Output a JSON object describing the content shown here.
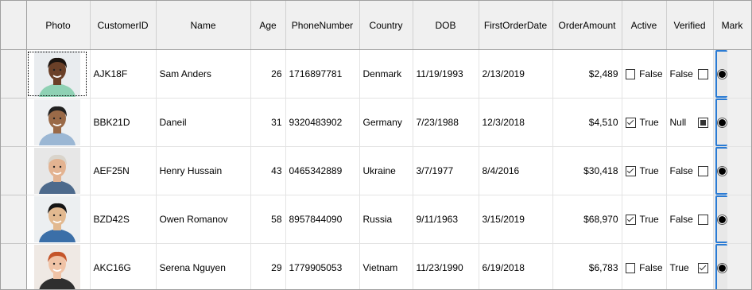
{
  "columns": {
    "photo": "Photo",
    "customer_id": "CustomerID",
    "name": "Name",
    "age": "Age",
    "phone": "PhoneNumber",
    "country": "Country",
    "dob": "DOB",
    "first_order": "FirstOrderDate",
    "order_amount": "OrderAmount",
    "active": "Active",
    "verified": "Verified",
    "mark": "Mark"
  },
  "colors": {
    "selection_blue": "#2a7bd4",
    "header_bg": "#f0f0f0"
  },
  "rows": [
    {
      "customer_id": "AJK18F",
      "name": "Sam Anders",
      "age": "26",
      "phone": "1716897781",
      "country": "Denmark",
      "dob": "11/19/1993",
      "first_order": "2/13/2019",
      "order_amount": "$2,489",
      "active": "False",
      "active_checked": false,
      "verified": "False",
      "verified_state": "unchecked",
      "avatar": {
        "skin": "#6b4028",
        "hair": "#1b1410",
        "shirt": "#8fd1b4",
        "bg": "#e9ecef"
      }
    },
    {
      "customer_id": "BBK21D",
      "name": "Daneil",
      "age": "31",
      "phone": "9320483902",
      "country": "Germany",
      "dob": "7/23/1988",
      "first_order": "12/3/2018",
      "order_amount": "$4,510",
      "active": "True",
      "active_checked": true,
      "verified": "Null",
      "verified_state": "indeterminate",
      "avatar": {
        "skin": "#9a6a48",
        "hair": "#202020",
        "shirt": "#9bb7d4",
        "bg": "#eef0f2"
      }
    },
    {
      "customer_id": "AEF25N",
      "name": "Henry Hussain",
      "age": "43",
      "phone": "0465342889",
      "country": "Ukraine",
      "dob": "3/7/1977",
      "first_order": "8/4/2016",
      "order_amount": "$30,418",
      "active": "True",
      "active_checked": true,
      "verified": "False",
      "verified_state": "unchecked",
      "avatar": {
        "skin": "#e3b391",
        "hair": "#d9d4cb",
        "shirt": "#4d6a8c",
        "bg": "#e7e7e7"
      }
    },
    {
      "customer_id": "BZD42S",
      "name": "Owen Romanov",
      "age": "58",
      "phone": "8957844090",
      "country": "Russia",
      "dob": "9/11/1963",
      "first_order": "3/15/2019",
      "order_amount": "$68,970",
      "active": "True",
      "active_checked": true,
      "verified": "False",
      "verified_state": "unchecked",
      "avatar": {
        "skin": "#e2b990",
        "hair": "#151515",
        "shirt": "#3b6fa8",
        "bg": "#eceff1"
      }
    },
    {
      "customer_id": "AKC16G",
      "name": "Serena Nguyen",
      "age": "29",
      "phone": "1779905053",
      "country": "Vietnam",
      "dob": "11/23/1990",
      "first_order": "6/19/2018",
      "order_amount": "$6,783",
      "active": "False",
      "active_checked": false,
      "verified": "True",
      "verified_state": "checked",
      "avatar": {
        "skin": "#f0c3a6",
        "hair": "#c5552a",
        "shirt": "#2f2f2f",
        "bg": "#efe9e4"
      }
    }
  ]
}
